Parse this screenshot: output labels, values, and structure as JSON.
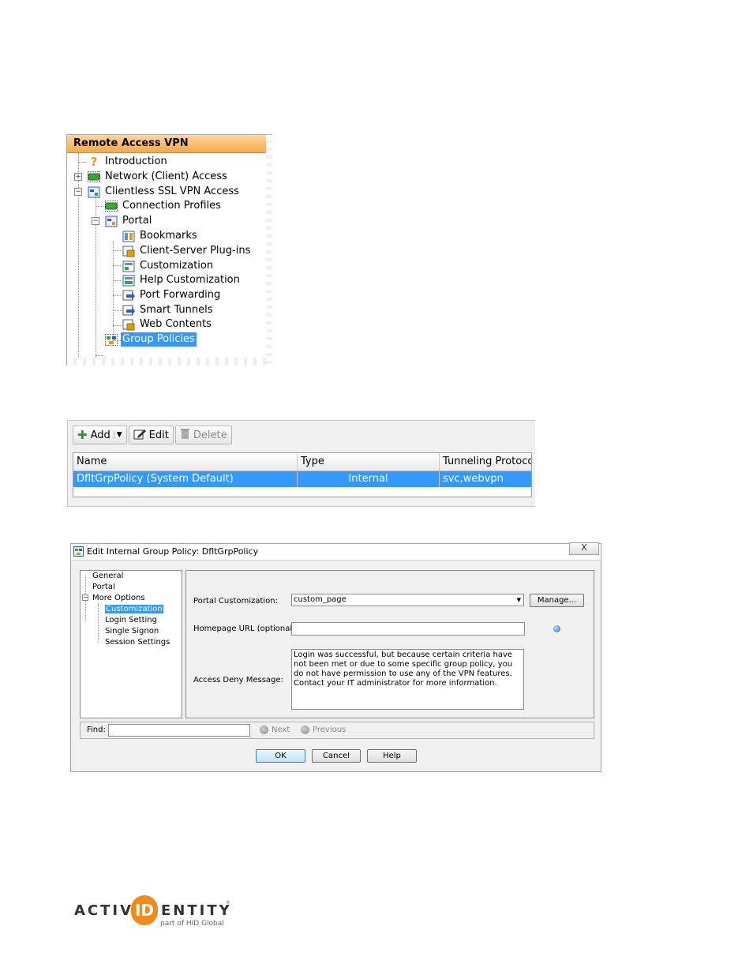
{
  "tree": {
    "header": "Remote Access VPN",
    "items": [
      {
        "label": "Introduction",
        "icon": "help-question-icon"
      },
      {
        "label": "Network (Client) Access",
        "icon": "network-access-icon"
      },
      {
        "label": "Clientless SSL VPN Access",
        "icon": "clientless-vpn-icon"
      },
      {
        "label": "Connection Profiles",
        "icon": "connection-profile-icon"
      },
      {
        "label": "Portal",
        "icon": "portal-icon"
      },
      {
        "label": "Bookmarks",
        "icon": "bookmarks-icon"
      },
      {
        "label": "Client-Server Plug-ins",
        "icon": "plugin-icon"
      },
      {
        "label": "Customization",
        "icon": "customization-icon"
      },
      {
        "label": "Help Customization",
        "icon": "help-customization-icon"
      },
      {
        "label": "Port Forwarding",
        "icon": "port-forwarding-icon"
      },
      {
        "label": "Smart Tunnels",
        "icon": "smart-tunnel-icon"
      },
      {
        "label": "Web Contents",
        "icon": "web-contents-icon"
      },
      {
        "label": "Group Policies",
        "icon": "group-policies-icon"
      }
    ],
    "selected": "Group Policies"
  },
  "group_policy": {
    "toolbar": {
      "add": "Add",
      "edit": "Edit",
      "delete": "Delete"
    },
    "columns": [
      "Name",
      "Type",
      "Tunneling Protocol"
    ],
    "rows": [
      {
        "name": "DfltGrpPolicy (System Default)",
        "type": "Internal",
        "protocol": "svc,webvpn"
      }
    ]
  },
  "dialog": {
    "title": "Edit Internal Group Policy: DfltGrpPolicy",
    "close": "X",
    "nav": [
      "General",
      "Portal",
      "More Options",
      "Customization",
      "Login Setting",
      "Single Signon",
      "Session Settings"
    ],
    "nav_selected": "Customization",
    "portal_customization_label": "Portal Customization:",
    "portal_customization_value": "custom_page",
    "manage_label": "Manage...",
    "homepage_url_label": "Homepage URL (optional):",
    "homepage_url_value": "",
    "access_deny_label": "Access Deny Message:",
    "access_deny_message": "Login was successful, but because certain criteria have not been met or due to some specific group policy, you do not have permission to use any of the VPN features. Contact your IT administrator for more information.",
    "find_label": "Find:",
    "find_value": "",
    "next_label": "Next",
    "previous_label": "Previous",
    "ok_label": "OK",
    "cancel_label": "Cancel",
    "help_label": "Help"
  },
  "logo": {
    "left": "ACTIV",
    "id": "ID",
    "right": "ENTITY",
    "reg": "®",
    "tagline": "part of HID Global"
  }
}
